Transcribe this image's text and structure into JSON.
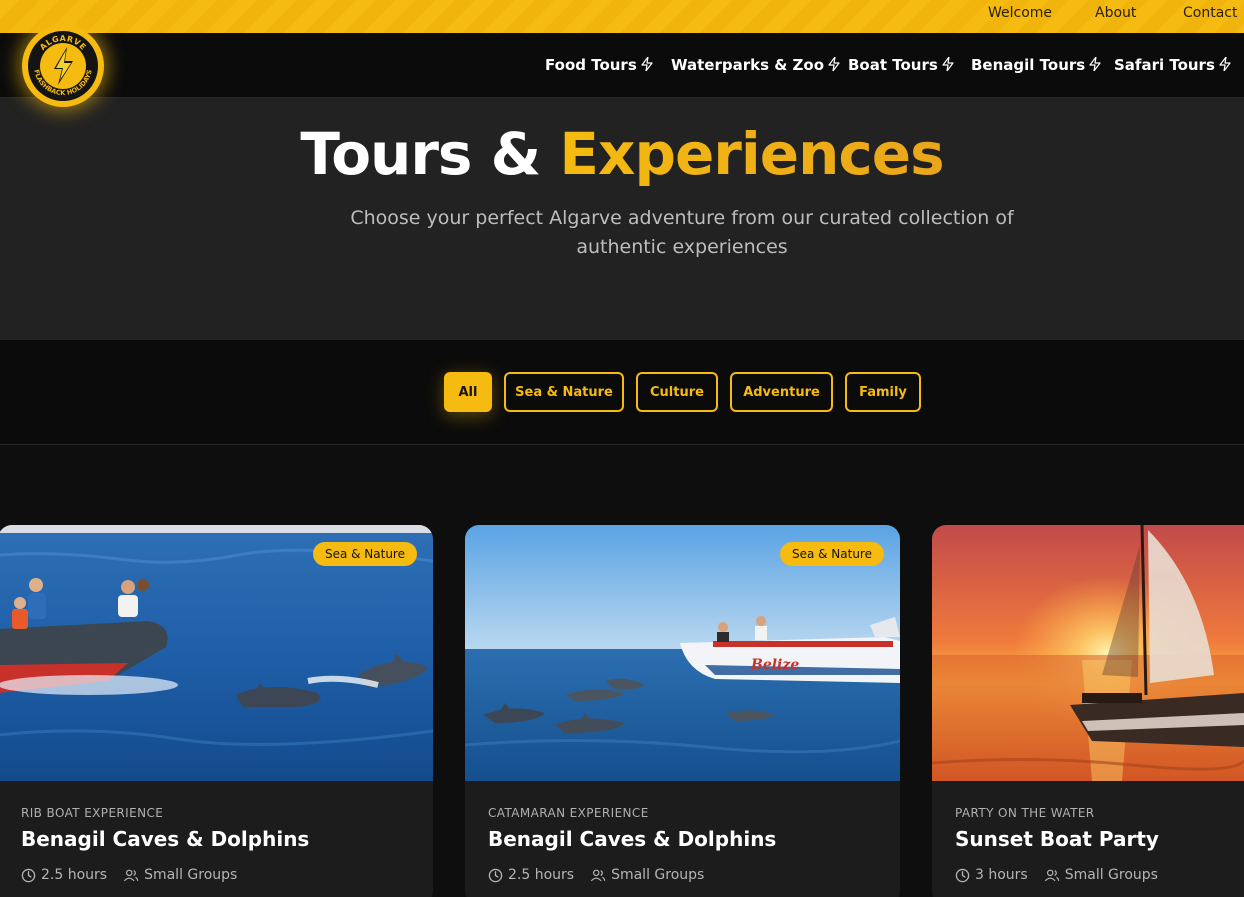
{
  "topbar": {
    "links": [
      "Welcome",
      "About",
      "Contact"
    ]
  },
  "logo": {
    "top_text": "ALGARVE",
    "bottom_text": "FLASHBACK HOLIDAYS"
  },
  "nav": {
    "items": [
      "Food Tours",
      "Waterparks & Zoo",
      "Boat Tours",
      "Benagil Tours",
      "Safari Tours"
    ]
  },
  "hero": {
    "title_plain": "Tours & ",
    "title_highlight": "Experiences",
    "subtitle": "Choose your perfect Algarve adventure from our curated collection of authentic experiences"
  },
  "filters": {
    "buttons": [
      "All",
      "Sea & Nature",
      "Culture",
      "Adventure",
      "Family"
    ],
    "active": "All"
  },
  "cards": [
    {
      "badge": "Sea & Nature",
      "kicker": "RIB BOAT EXPERIENCE",
      "title": "Benagil Caves & Dolphins",
      "duration": "2.5 hours",
      "group": "Small Groups"
    },
    {
      "badge": "Sea & Nature",
      "kicker": "CATAMARAN EXPERIENCE",
      "title": "Benagil Caves & Dolphins",
      "duration": "2.5 hours",
      "group": "Small Groups"
    },
    {
      "badge": "",
      "kicker": "PARTY ON THE WATER",
      "title": "Sunset Boat Party",
      "duration": "3 hours",
      "group": "Small Groups"
    }
  ],
  "colors": {
    "accent": "#f5bb10",
    "background": "#0e0e0e",
    "hero_bg": "#222222",
    "card_bg": "#1c1c1c"
  }
}
